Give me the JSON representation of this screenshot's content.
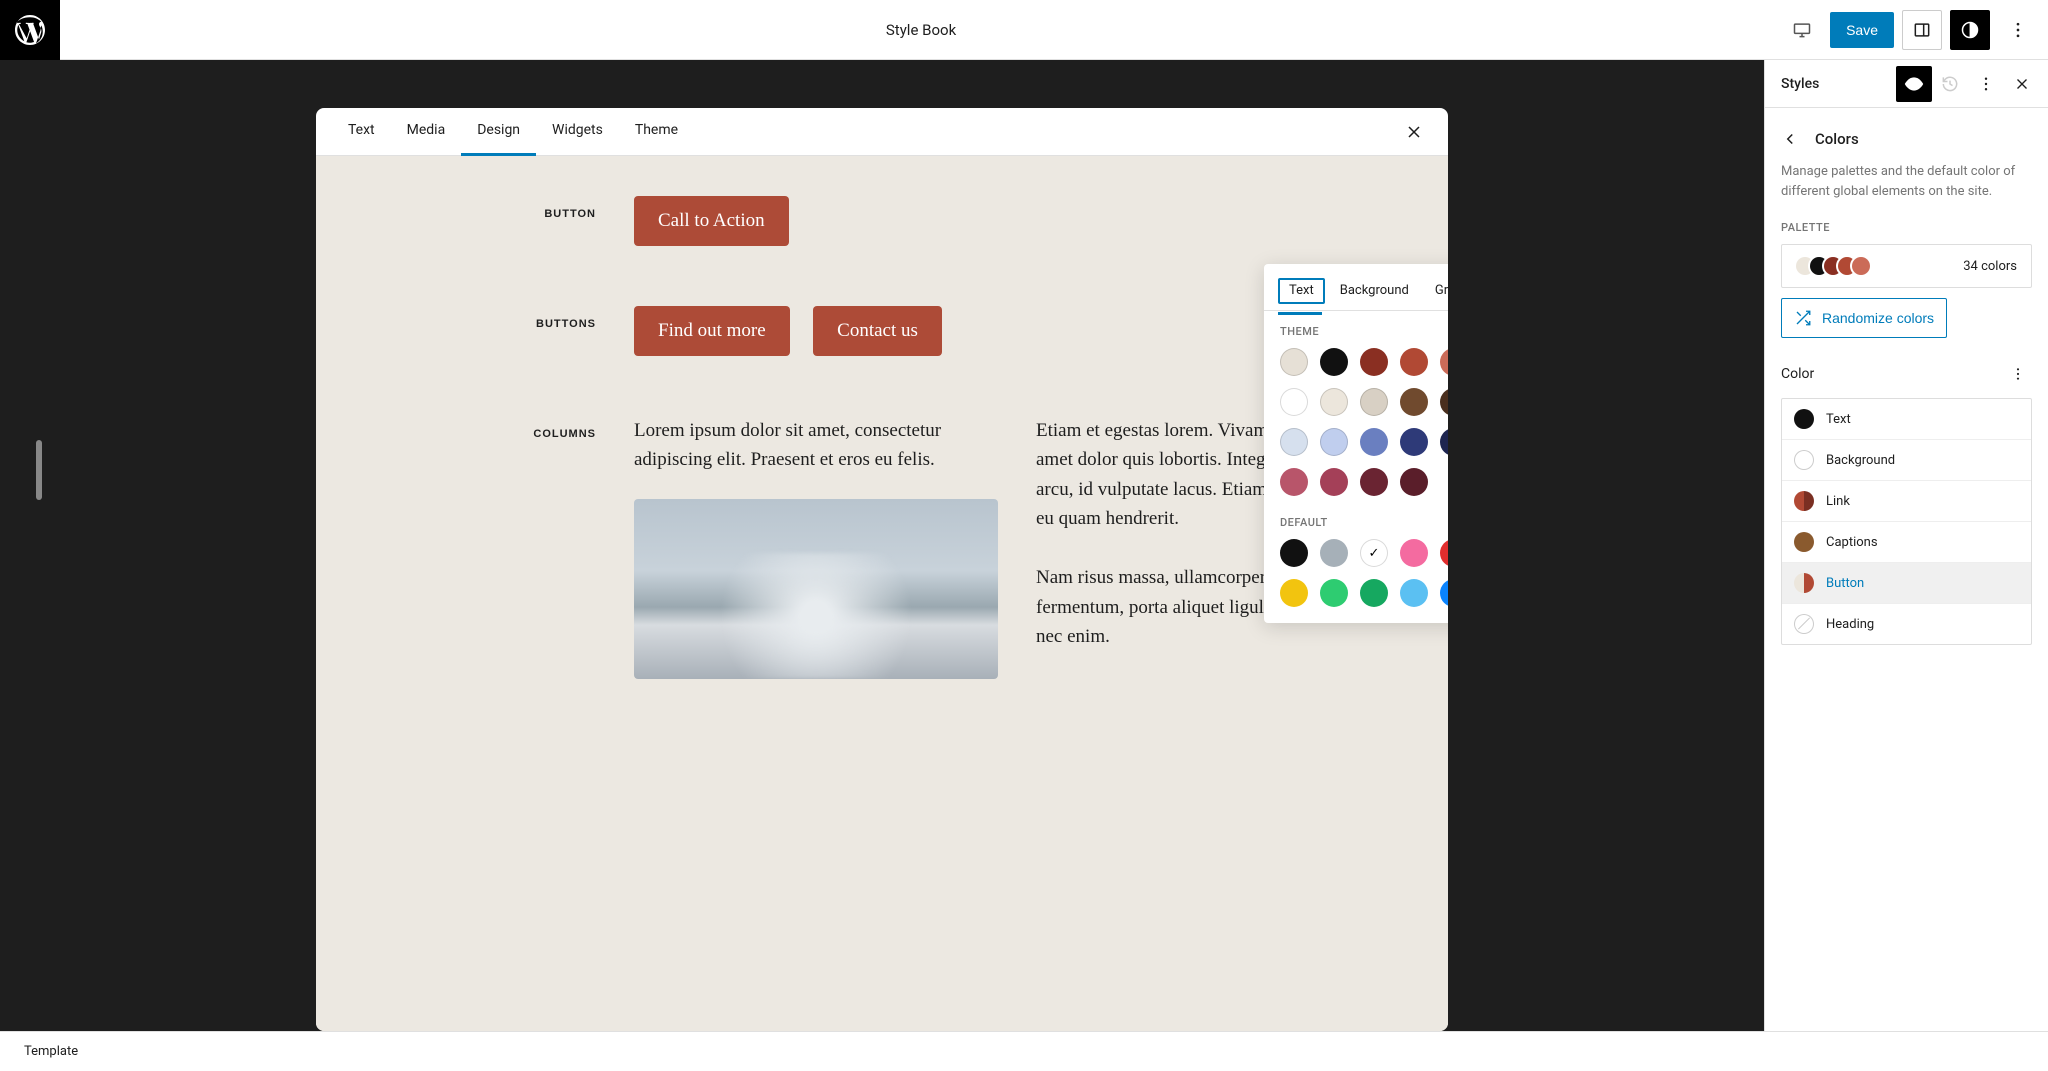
{
  "header": {
    "title": "Style Book",
    "save_label": "Save"
  },
  "tabs": [
    "Text",
    "Media",
    "Design",
    "Widgets",
    "Theme"
  ],
  "active_tab": "Design",
  "labels": {
    "button": "BUTTON",
    "buttons": "BUTTONS",
    "columns": "COLUMNS"
  },
  "preview": {
    "cta": "Call to Action",
    "find_out": "Find out more",
    "contact": "Contact us",
    "col1": "Lorem ipsum dolor sit amet, consectetur adipiscing elit. Praesent et eros eu felis.",
    "col2a": "Etiam et egestas lorem. Vivamus sagittis sit amet dolor quis lobortis. Integer sed fermentum arcu, id vulputate lacus. Etiam fermentum sem eu quam hendrerit.",
    "col2b": "Nam risus massa, ullamcorper consectetur eros fermentum, porta aliquet ligula. Sed vel mauris nec enim."
  },
  "popover": {
    "tabs": [
      "Text",
      "Background",
      "Gradient"
    ],
    "theme_label": "THEME",
    "default_label": "DEFAULT",
    "theme_colors": [
      "#e6e0d6",
      "#111111",
      "#8a2f22",
      "#b14934",
      "#cb6b58",
      "#f0c4b8",
      "#ffffff",
      "#ece6dc",
      "#d8d0c4",
      "#704a2e",
      "#4a2f1e",
      "#2a1a12",
      "#d6e0ee",
      "#c0ceee",
      "#6a7fc0",
      "#2e3a78",
      "#1e2550",
      "#eeced8",
      "#b8556a",
      "#a44058",
      "#6a2432",
      "#5a1e2a"
    ],
    "default_colors": [
      "#111111",
      "#a6b0b8",
      "#ffffff",
      "#f46ba0",
      "#e12d2d",
      "#f5831f",
      "#f2c40f",
      "#2ecc71",
      "#16a860",
      "#5bc0f2",
      "#0a84ff",
      "#9b51e0"
    ],
    "selected_default_index": 2
  },
  "sidebar": {
    "title": "Styles",
    "nav_title": "Colors",
    "description": "Manage palettes and the default color of different global elements on the site.",
    "palette_label": "PALETTE",
    "palette_count": "34 colors",
    "palette_dots": [
      "#ece6dc",
      "#111111",
      "#8a2f22",
      "#b14934",
      "#cb6b58"
    ],
    "randomize_label": "Randomize colors",
    "color_label": "Color",
    "items": [
      {
        "label": "Text",
        "chip": {
          "type": "solid",
          "c": "#111111"
        }
      },
      {
        "label": "Background",
        "chip": {
          "type": "outline"
        }
      },
      {
        "label": "Link",
        "chip": {
          "type": "split",
          "c1": "#b14934",
          "c2": "#7a2f22"
        }
      },
      {
        "label": "Captions",
        "chip": {
          "type": "solid",
          "c": "#8a5a2e"
        }
      },
      {
        "label": "Button",
        "chip": {
          "type": "split",
          "c1": "#ece6dc",
          "c2": "#b14934"
        },
        "active": true
      },
      {
        "label": "Heading",
        "chip": {
          "type": "empty"
        }
      }
    ]
  },
  "footer": {
    "label": "Template"
  }
}
